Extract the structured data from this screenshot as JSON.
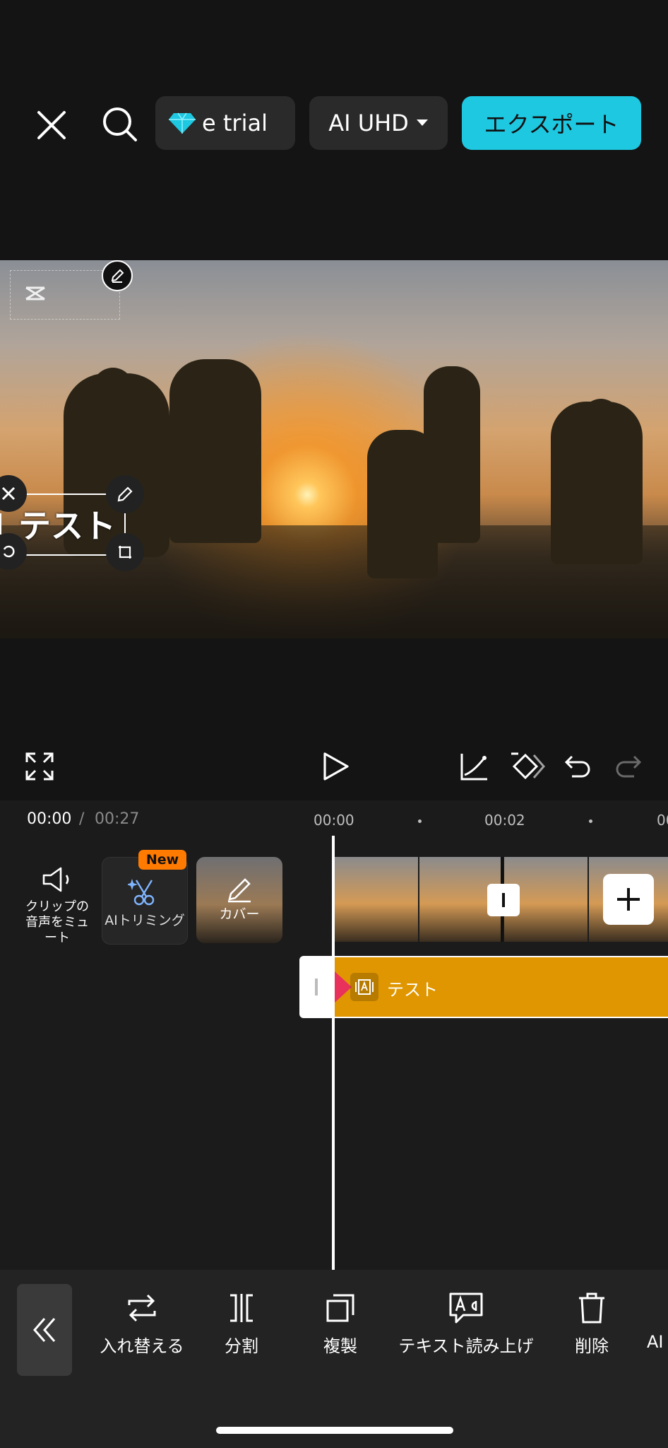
{
  "header": {
    "trial_label": "e trial",
    "quality_label": "AI UHD",
    "export_label": "エクスポート"
  },
  "preview": {
    "text_overlay": "テスト"
  },
  "timeline": {
    "current_time": "00:00",
    "separator": "/",
    "total_time": "00:27",
    "ruler": [
      "00:00",
      "00:02",
      "00:"
    ],
    "mute_label": "クリップの音声をミュート",
    "ai_trim_label": "AIトリミング",
    "new_badge": "New",
    "cover_label": "カバー",
    "text_track_label": "テスト"
  },
  "toolbar": {
    "items": [
      "入れ替える",
      "分割",
      "複製",
      "テキスト読み上げ",
      "削除",
      "AI"
    ]
  },
  "colors": {
    "accent": "#1ec8e1",
    "text_track": "#e09600",
    "keyframe": "#e8315b",
    "badge": "#ff7a00"
  }
}
